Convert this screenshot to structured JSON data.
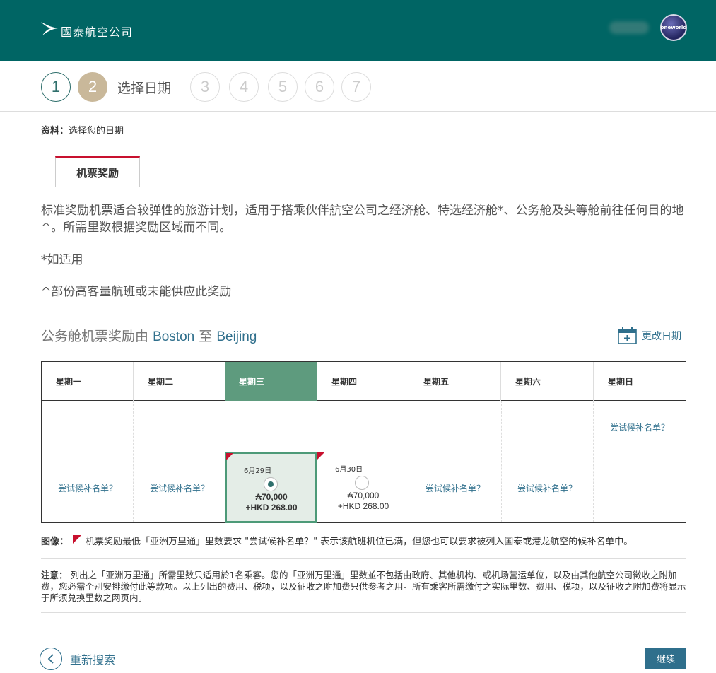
{
  "header": {
    "logo_text": "國泰航空公司",
    "oneworld": "oneworld"
  },
  "stepper": {
    "steps": [
      "1",
      "2",
      "3",
      "4",
      "5",
      "6",
      "7"
    ],
    "active_label": "选择日期"
  },
  "breadcrumb": {
    "label": "资料：",
    "value": "选择您的日期"
  },
  "tab": {
    "label": "机票奖励"
  },
  "description": {
    "main": "标准奖励机票适合较弹性的旅游计划，适用于搭乘伙伴航空公司之经济舱、特选经济舱*、公务舱及头等舱前往任何目的地^。所需里数根据奖励区域而不同。",
    "note1": "*如适用",
    "note2": "^部份高客量航班或未能供应此奖励"
  },
  "route": {
    "prefix": "公务舱机票奖励由",
    "origin": "Boston",
    "connector": "至",
    "destination": "Beijing",
    "change_date": "更改日期"
  },
  "calendar": {
    "days": [
      "星期一",
      "星期二",
      "星期三",
      "星期四",
      "星期五",
      "星期六",
      "星期日"
    ],
    "selected_day_index": 2,
    "waitlist_text": "尝试候补名单？",
    "wed": {
      "date": "6月29日",
      "miles": "70,000",
      "price": "+HKD 268.00"
    },
    "thu": {
      "date": "6月30日",
      "miles": "70,000",
      "price": "+HKD 268.00"
    }
  },
  "legend": {
    "label": "图像：",
    "text": "机票奖励最低「亚洲万里通」里数要求  \"尝试候补名单？\" 表示该航班机位已满，但您也可以要求被列入国泰或港龙航空的候补名单中。"
  },
  "remark": {
    "label": "注意：",
    "text": "列出之「亚洲万里通」所需里数只适用於1名乘客。您的「亚洲万里通」里数並不包括由政府、其他机构、或机场营运单位，以及由其他航空公司徵收之附加费，您必需个别安排缴付此等款项。以上列出的费用、税项，以及征收之附加费只供参考之用。所有乘客所需缴付之实际里数、费用、税项，以及征收之附加费将显示于所须兑换里数之网页内。"
  },
  "footer": {
    "back": "重新搜索",
    "continue": "继续"
  },
  "colors": {
    "header_bg": "#006564",
    "accent_red": "#c8102e",
    "selected_green": "#5e9b7e",
    "link_blue": "#2f6f8c"
  }
}
